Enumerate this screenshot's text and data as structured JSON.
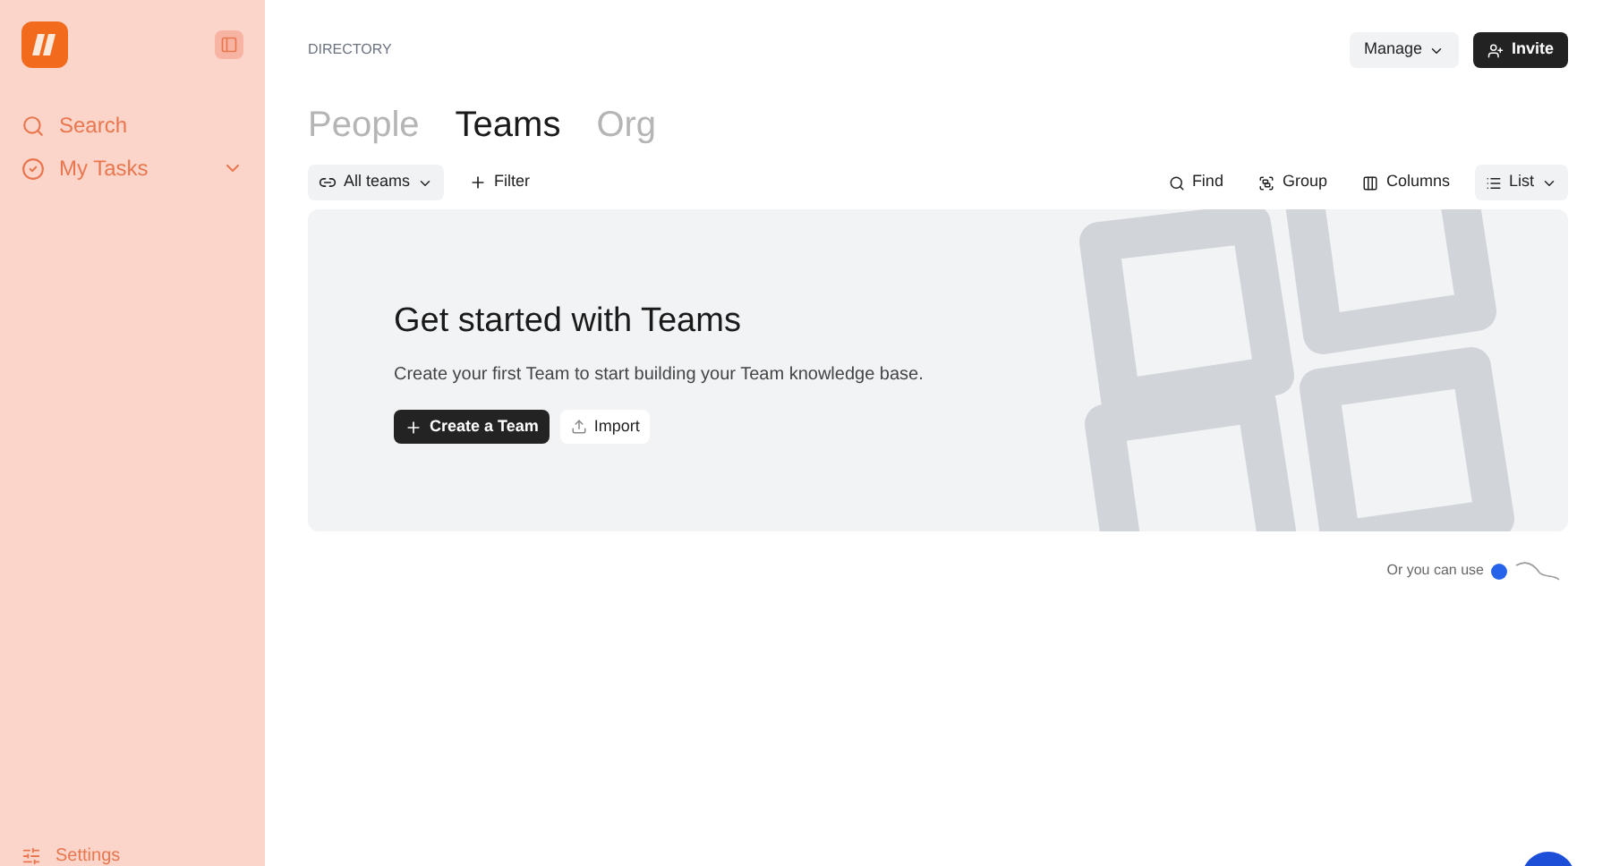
{
  "sidebar": {
    "items": [
      {
        "kind": "search",
        "label": "Search",
        "expandable": false
      },
      {
        "kind": "tasks",
        "label": "My Tasks",
        "expandable": true
      }
    ],
    "footer": {
      "label": "Settings"
    }
  },
  "header": {
    "breadcrumb": "DIRECTORY",
    "manage": "Manage",
    "invite": "Invite"
  },
  "tabs": [
    {
      "label": "People",
      "selected": false
    },
    {
      "label": "Teams",
      "selected": true
    },
    {
      "label": "Org",
      "selected": false
    }
  ],
  "toolbar": {
    "filter_menu": "All teams",
    "filter": "Filter",
    "actions": [
      {
        "kind": "find",
        "label": "Find"
      },
      {
        "kind": "group",
        "label": "Group"
      },
      {
        "kind": "columns",
        "label": "Columns"
      }
    ],
    "view": "List"
  },
  "empty_state": {
    "title": "Get started with Teams",
    "description": "Create your first Team to start building your Team knowledge base.",
    "primary": "Create a Team",
    "secondary": "Import"
  },
  "hint": "Or you can use"
}
